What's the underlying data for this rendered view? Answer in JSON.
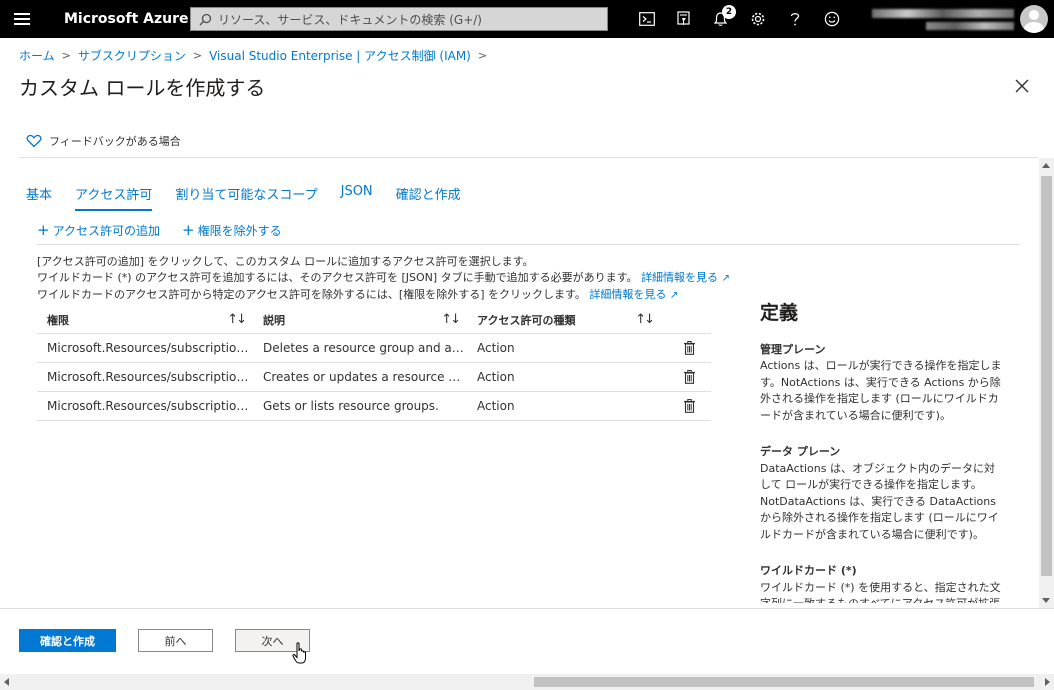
{
  "topbar": {
    "brand": "Microsoft Azure",
    "search_placeholder": "リソース、サービス、ドキュメントの検索 (G+/)",
    "notification_count": "2",
    "icons": [
      "cloud-shell-icon",
      "directory-filter-icon",
      "notifications-icon",
      "settings-icon",
      "help-icon",
      "feedback-smiley-icon"
    ]
  },
  "breadcrumb": [
    "ホーム",
    "サブスクリプション",
    "Visual Studio Enterprise | アクセス制御 (IAM)"
  ],
  "page_title": "カスタム ロールを作成する",
  "feedback_label": "フィードバックがある場合",
  "tabs": [
    {
      "label": "基本",
      "active": false
    },
    {
      "label": "アクセス許可",
      "active": true
    },
    {
      "label": "割り当て可能なスコープ",
      "active": false
    },
    {
      "label": "JSON",
      "active": false
    },
    {
      "label": "確認と作成",
      "active": false
    }
  ],
  "actions": {
    "add_permissions": "アクセス許可の追加",
    "exclude_permissions": "権限を除外する"
  },
  "info": {
    "line1": "[アクセス許可の追加] をクリックして、このカスタム ロールに追加するアクセス許可を選択します。",
    "line2": "ワイルドカード (*) のアクセス許可を追加するには、そのアクセス許可を [JSON] タブに手動で追加する必要があります。",
    "line3": "ワイルドカードのアクセス許可から特定のアクセス許可を除外するには、[権限を除外する] をクリックします。",
    "learn_more": "詳細情報を見る"
  },
  "table": {
    "headers": [
      "権限",
      "説明",
      "アクセス許可の種類"
    ],
    "rows": [
      {
        "permission": "Microsoft.Resources/subscriptions/resourceGroups/delete",
        "description": "Deletes a resource group and all its resources.",
        "type": "Action"
      },
      {
        "permission": "Microsoft.Resources/subscriptions/resourceGroups/write",
        "description": "Creates or updates a resource group.",
        "type": "Action"
      },
      {
        "permission": "Microsoft.Resources/subscriptions/resourceGroups/read",
        "description": "Gets or lists resource groups.",
        "type": "Action"
      }
    ]
  },
  "definition": {
    "title": "定義",
    "sections": [
      {
        "heading": "管理プレーン",
        "body": "Actions は、ロールが実行できる操作を指定します。NotActions は、実行できる Actions から除外される操作を指定します (ロールにワイルドカードが含まれている場合に便利です)。"
      },
      {
        "heading": "データ プレーン",
        "body": "DataActions は、オブジェクト内のデータに対して ロールが実行できる操作を指定します。NotDataActions は、実行できる DataActions から除外される操作を指定します (ロールにワイルドカードが含まれている場合に便利です)。"
      },
      {
        "heading": "ワイルドカード (*)",
        "body": "ワイルドカード (*) を使用すると、指定された文字列に一致するものすべてにアクセス許可が拡張されま"
      }
    ]
  },
  "footer": {
    "review_create": "確認と作成",
    "previous": "前へ",
    "next": "次へ"
  }
}
